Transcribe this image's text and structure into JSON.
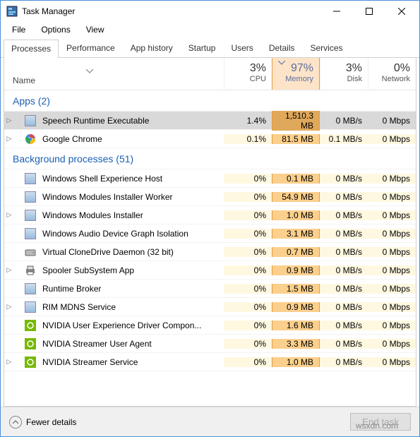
{
  "window": {
    "title": "Task Manager"
  },
  "menu": {
    "file": "File",
    "options": "Options",
    "view": "View"
  },
  "tabs": {
    "processes": "Processes",
    "performance": "Performance",
    "apphistory": "App history",
    "startup": "Startup",
    "users": "Users",
    "details": "Details",
    "services": "Services"
  },
  "columns": {
    "name": "Name",
    "cpu": {
      "pct": "3%",
      "label": "CPU"
    },
    "memory": {
      "pct": "97%",
      "label": "Memory"
    },
    "disk": {
      "pct": "3%",
      "label": "Disk"
    },
    "network": {
      "pct": "0%",
      "label": "Network"
    }
  },
  "groups": {
    "apps": "Apps (2)",
    "background": "Background processes (51)"
  },
  "rows": [
    {
      "group": "apps"
    },
    {
      "expand": true,
      "selected": true,
      "icon": "app-icon",
      "name": "Speech Runtime Executable",
      "cpu": "1.4%",
      "mem": "1,510.3 MB",
      "disk": "0 MB/s",
      "net": "0 Mbps"
    },
    {
      "expand": true,
      "icon": "chrome-icon",
      "name": "Google Chrome",
      "cpu": "0.1%",
      "mem": "81.5 MB",
      "disk": "0.1 MB/s",
      "net": "0 Mbps"
    },
    {
      "group": "background"
    },
    {
      "icon": "app-icon",
      "name": "Windows Shell Experience Host",
      "cpu": "0%",
      "mem": "0.1 MB",
      "disk": "0 MB/s",
      "net": "0 Mbps"
    },
    {
      "icon": "app-icon",
      "name": "Windows Modules Installer Worker",
      "cpu": "0%",
      "mem": "54.9 MB",
      "disk": "0 MB/s",
      "net": "0 Mbps"
    },
    {
      "expand": true,
      "icon": "app-icon",
      "name": "Windows Modules Installer",
      "cpu": "0%",
      "mem": "1.0 MB",
      "disk": "0 MB/s",
      "net": "0 Mbps"
    },
    {
      "icon": "app-icon",
      "name": "Windows Audio Device Graph Isolation",
      "cpu": "0%",
      "mem": "3.1 MB",
      "disk": "0 MB/s",
      "net": "0 Mbps"
    },
    {
      "icon": "drive-icon",
      "name": "Virtual CloneDrive Daemon (32 bit)",
      "cpu": "0%",
      "mem": "0.7 MB",
      "disk": "0 MB/s",
      "net": "0 Mbps"
    },
    {
      "expand": true,
      "icon": "printer-icon",
      "name": "Spooler SubSystem App",
      "cpu": "0%",
      "mem": "0.9 MB",
      "disk": "0 MB/s",
      "net": "0 Mbps"
    },
    {
      "icon": "app-icon",
      "name": "Runtime Broker",
      "cpu": "0%",
      "mem": "1.5 MB",
      "disk": "0 MB/s",
      "net": "0 Mbps"
    },
    {
      "expand": true,
      "icon": "app-icon",
      "name": "RIM MDNS Service",
      "cpu": "0%",
      "mem": "0.9 MB",
      "disk": "0 MB/s",
      "net": "0 Mbps"
    },
    {
      "icon": "nvidia-icon",
      "name": "NVIDIA User Experience Driver Compon...",
      "cpu": "0%",
      "mem": "1.6 MB",
      "disk": "0 MB/s",
      "net": "0 Mbps"
    },
    {
      "icon": "nvidia-icon",
      "name": "NVIDIA Streamer User Agent",
      "cpu": "0%",
      "mem": "3.3 MB",
      "disk": "0 MB/s",
      "net": "0 Mbps"
    },
    {
      "expand": true,
      "icon": "nvidia-icon",
      "name": "NVIDIA Streamer Service",
      "cpu": "0%",
      "mem": "1.0 MB",
      "disk": "0 MB/s",
      "net": "0 Mbps"
    }
  ],
  "footer": {
    "fewer": "Fewer details",
    "endtask": "End task"
  },
  "watermark": "wsxdn.com"
}
